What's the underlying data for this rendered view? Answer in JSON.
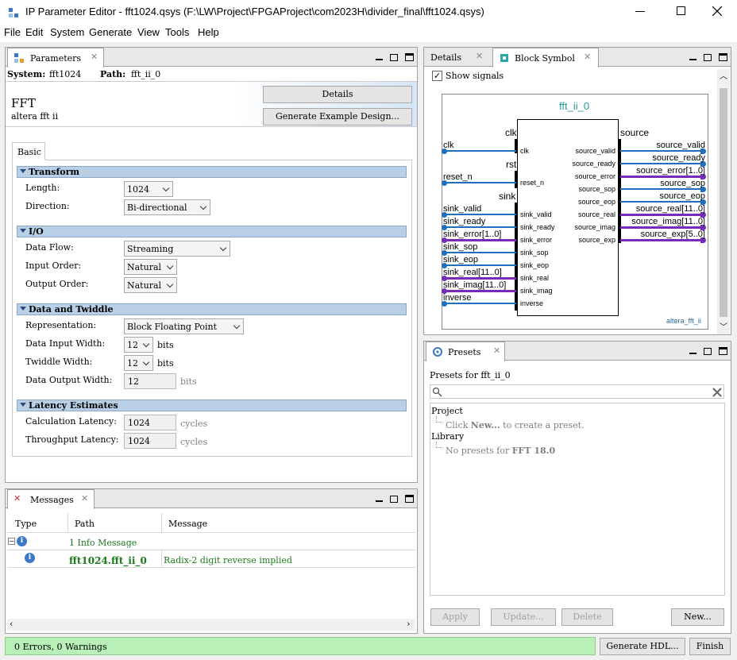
{
  "window": {
    "title": "IP Parameter Editor - fft1024.qsys (F:\\LW\\Project\\FPGAProject\\com2023H\\divider_final\\fft1024.qsys)"
  },
  "menu": [
    "File",
    "Edit",
    "System",
    "Generate",
    "View",
    "Tools",
    "Help"
  ],
  "parameters": {
    "tab": "Parameters",
    "system_label": "System:",
    "system_value": "fft1024",
    "path_label": "Path:",
    "path_value": "fft_ii_0",
    "ip_name": "FFT",
    "ip_sub": "altera fft ii",
    "details_btn": "Details",
    "example_btn": "Generate Example Design...",
    "basic_tab": "Basic",
    "transform": {
      "title": "Transform",
      "length_label": "Length:",
      "length_value": "1024",
      "direction_label": "Direction:",
      "direction_value": "Bi-directional"
    },
    "io": {
      "title": "I/O",
      "dataflow_label": "Data Flow:",
      "dataflow_value": "Streaming",
      "input_order_label": "Input Order:",
      "input_order_value": "Natural",
      "output_order_label": "Output Order:",
      "output_order_value": "Natural"
    },
    "twiddle": {
      "title": "Data and Twiddle",
      "rep_label": "Representation:",
      "rep_value": "Block Floating Point",
      "diw_label": "Data Input Width:",
      "diw_value": "12",
      "tw_label": "Twiddle Width:",
      "tw_value": "12",
      "dow_label": "Data Output Width:",
      "dow_value": "12",
      "bits": "bits"
    },
    "latency": {
      "title": "Latency Estimates",
      "calc_label": "Calculation Latency:",
      "calc_value": "1024",
      "thr_label": "Throughput Latency:",
      "thr_value": "1024",
      "cycles": "cycles"
    }
  },
  "details_tab": "Details",
  "block": {
    "tab": "Block Symbol",
    "show_signals": "Show signals",
    "instance": "fft_ii_0",
    "module": "altera_fft_ii",
    "grp_clk": "clk",
    "grp_rst": "rst",
    "grp_sink": "sink",
    "grp_source": "source",
    "inputs": [
      {
        "ext": "clk",
        "port": "clk"
      },
      {
        "ext": "reset_n",
        "port": "reset_n"
      },
      {
        "ext": "sink_valid",
        "port": "sink_valid"
      },
      {
        "ext": "sink_ready",
        "port": "sink_ready"
      },
      {
        "ext": "sink_error[1..0]",
        "port": "sink_error"
      },
      {
        "ext": "sink_sop",
        "port": "sink_sop"
      },
      {
        "ext": "sink_eop",
        "port": "sink_eop"
      },
      {
        "ext": "sink_real[11..0]",
        "port": "sink_real"
      },
      {
        "ext": "sink_imag[11..0]",
        "port": "sink_imag"
      },
      {
        "ext": "inverse",
        "port": "inverse"
      }
    ],
    "outputs": [
      {
        "ext": "source_valid",
        "port": "source_valid"
      },
      {
        "ext": "source_ready",
        "port": "source_ready"
      },
      {
        "ext": "source_error[1..0]",
        "port": "source_error"
      },
      {
        "ext": "source_sop",
        "port": "source_sop"
      },
      {
        "ext": "source_eop",
        "port": "source_eop"
      },
      {
        "ext": "source_real[11..0]",
        "port": "source_real"
      },
      {
        "ext": "source_imag[11..0]",
        "port": "source_imag"
      },
      {
        "ext": "source_exp[5..0]",
        "port": "source_exp"
      }
    ]
  },
  "presets": {
    "tab": "Presets",
    "for_label": "Presets for fft_ii_0",
    "project": "Project",
    "project_hint_pre": "Click ",
    "project_hint_new": "New...",
    "project_hint_post": " to create a preset.",
    "library": "Library",
    "library_hint_pre": "No presets for ",
    "library_hint_bold": "FFT 18.0",
    "apply": "Apply",
    "update": "Update...",
    "delete": "Delete",
    "new": "New..."
  },
  "messages": {
    "tab": "Messages",
    "col_type": "Type",
    "col_path": "Path",
    "col_message": "Message",
    "row1_path": "1 Info Message",
    "row2_path": "fft1024.fft_ii_0",
    "row2_msg": "Radix-2 digit reverse implied"
  },
  "status": {
    "text": "0 Errors, 0 Warnings",
    "generate": "Generate HDL...",
    "finish": "Finish"
  },
  "colors": {
    "accent": "#1f6fc0",
    "bus": "#7a2ab8",
    "section": "#b8cfe6",
    "status_ok": "#b8f0b8",
    "info_green": "#1a7a1a"
  }
}
